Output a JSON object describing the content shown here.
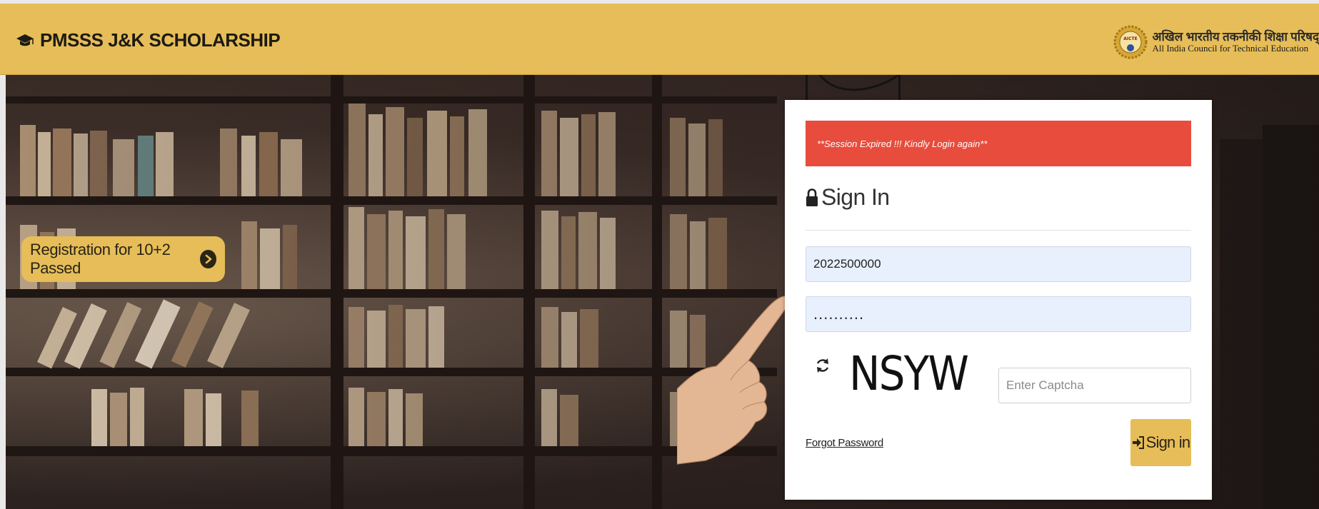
{
  "header": {
    "brand": "PMSSS J&K SCHOLARSHIP",
    "org_hindi": "अखिल भारतीय तकनीकी शिक्षा परिषद्",
    "org_english": "All India Council for Technical Education",
    "logo_text": "AICTE",
    "bg_color": "#e6bd58"
  },
  "hero": {
    "registration_button": "Registration for 10+2 Passed"
  },
  "login": {
    "alert": "**Session Expired !!! Kindly Login again**",
    "title": "Sign In",
    "username_value": "2022500000",
    "password_value": "..........",
    "captcha_text": "NSYW",
    "captcha_placeholder": "Enter Captcha",
    "forgot_password": "Forgot Password",
    "signin_button": "Sign in",
    "alert_color": "#e74c3c"
  },
  "icons": {
    "brand": "graduation-cap-icon",
    "registration": "chevron-right-circle-icon",
    "title": "lock-icon",
    "captcha_refresh": "refresh-icon",
    "signin": "sign-in-icon"
  }
}
